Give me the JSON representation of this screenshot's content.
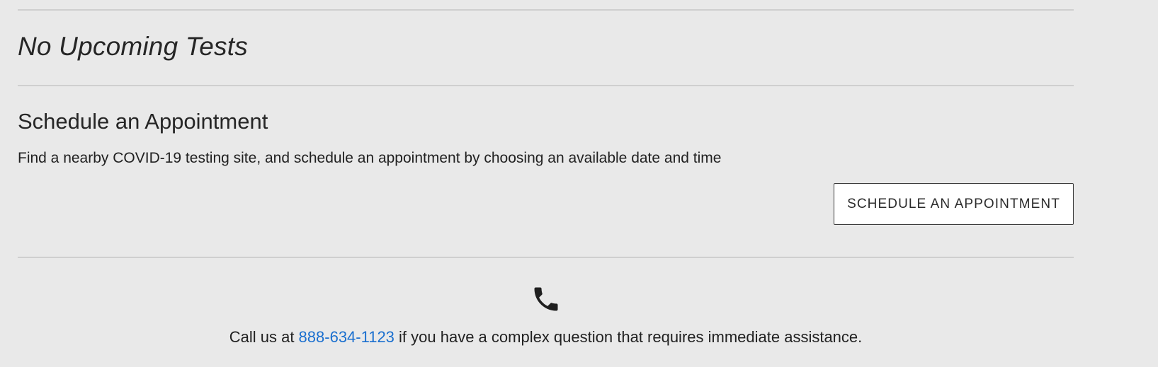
{
  "upcoming": {
    "empty_text": "No Upcoming Tests"
  },
  "schedule": {
    "heading": "Schedule an Appointment",
    "description": "Find a nearby COVID-19 testing site, and schedule an appointment by choosing an available date and time",
    "button_label": "SCHEDULE AN APPOINTMENT"
  },
  "contact": {
    "icon": "phone-icon",
    "prefix": "Call us at ",
    "phone": "888-634-1123",
    "suffix": " if you have a complex question that requires immediate assistance."
  },
  "colors": {
    "background": "#e9e9e9",
    "divider": "#cfcfcf",
    "link": "#1a6fcf",
    "text": "#212121"
  }
}
